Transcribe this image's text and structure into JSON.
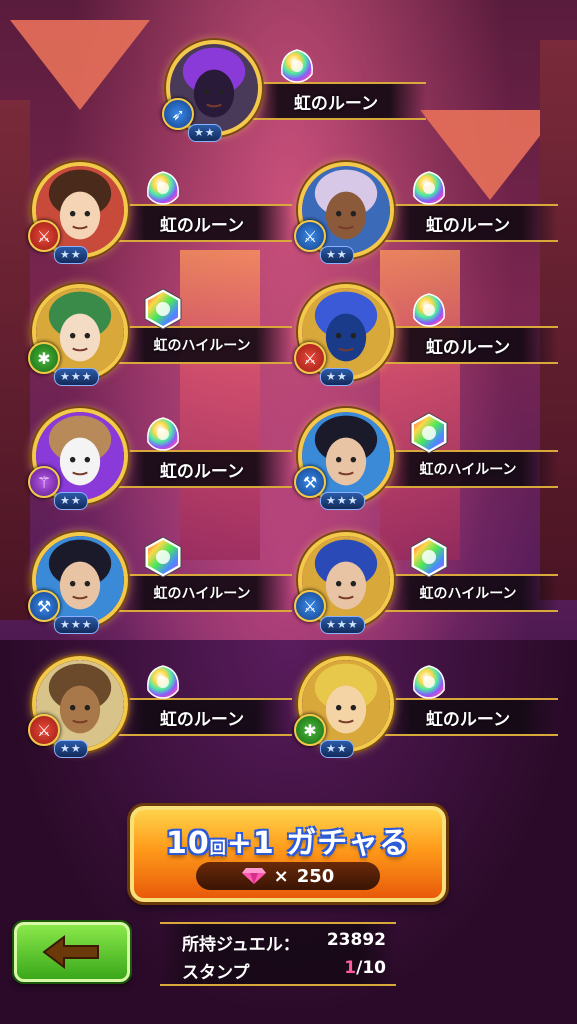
{
  "units": [
    {
      "rune_label": "虹のルーン",
      "element": "blue",
      "element_icon": "bow-icon",
      "stars": "★★",
      "rune_type": "rainbow-rune-icon",
      "portrait": "dark-knight-portrait"
    },
    {
      "rune_label": "虹のルーン",
      "element": "red",
      "element_icon": "sword-icon",
      "stars": "★★",
      "rune_type": "rainbow-rune-icon",
      "portrait": "brown-haired-girl-portrait"
    },
    {
      "rune_label": "虹のルーン",
      "element": "blue",
      "element_icon": "sword-icon",
      "stars": "★★",
      "rune_type": "rainbow-rune-icon",
      "portrait": "silver-haired-elf-portrait"
    },
    {
      "rune_label": "虹のハイルーン",
      "element": "green",
      "element_icon": "claw-icon",
      "stars": "★★★",
      "rune_type": "rainbow-high-rune-icon",
      "portrait": "green-haired-girl-portrait"
    },
    {
      "rune_label": "虹のルーン",
      "element": "red",
      "element_icon": "sword-icon",
      "stars": "★★",
      "rune_type": "rainbow-rune-icon",
      "portrait": "blue-armor-knight-portrait"
    },
    {
      "rune_label": "虹のルーン",
      "element": "purple",
      "element_icon": "staff-icon",
      "stars": "★★",
      "rune_type": "rainbow-rune-icon",
      "portrait": "white-cat-portrait"
    },
    {
      "rune_label": "虹のハイルーン",
      "element": "blue",
      "element_icon": "axe-icon",
      "stars": "★★★",
      "rune_type": "rainbow-high-rune-icon",
      "portrait": "sunglasses-man-portrait"
    },
    {
      "rune_label": "虹のハイルーン",
      "element": "blue",
      "element_icon": "axe-icon",
      "stars": "★★★",
      "rune_type": "rainbow-high-rune-icon",
      "portrait": "sunglasses-man-portrait"
    },
    {
      "rune_label": "虹のハイルーン",
      "element": "blue",
      "element_icon": "sword-icon",
      "stars": "★★★",
      "rune_type": "rainbow-high-rune-icon",
      "portrait": "blue-haired-woman-portrait"
    },
    {
      "rune_label": "虹のルーン",
      "element": "red",
      "element_icon": "sword-icon",
      "stars": "★★",
      "rune_type": "rainbow-rune-icon",
      "portrait": "brown-cat-portrait"
    },
    {
      "rune_label": "虹のルーン",
      "element": "green",
      "element_icon": "claw-icon",
      "stars": "★★",
      "rune_type": "rainbow-rune-icon",
      "portrait": "blonde-eyepatch-boy-portrait"
    }
  ],
  "gacha_button": {
    "title_main": "10",
    "title_unit": "回",
    "title_plus": "+1",
    "title_text": "ガチャる",
    "cost_prefix": "×",
    "cost_value": "250"
  },
  "info": {
    "jewel_label": "所持ジュエル：",
    "jewel_value": "23892",
    "stamp_label": "スタンプ",
    "stamp_current": "1",
    "stamp_total": "/10"
  },
  "colors": {
    "accent_gold": "#f3c94a",
    "button_orange": "#ff9a1a",
    "back_green": "#3aa81a",
    "stamp_pink": "#ff5aa0"
  }
}
